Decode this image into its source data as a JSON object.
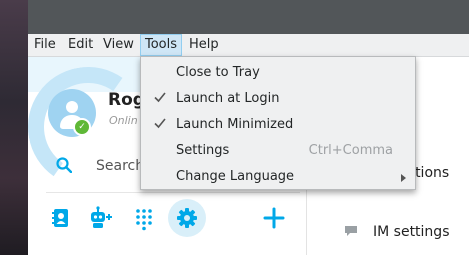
{
  "menubar": {
    "items": [
      {
        "label": "File"
      },
      {
        "label": "Edit"
      },
      {
        "label": "View"
      },
      {
        "label": "Tools",
        "active": true
      },
      {
        "label": "Help"
      }
    ]
  },
  "profile": {
    "name": "Rog",
    "status": "Onlin"
  },
  "search": {
    "label": "Search"
  },
  "toolbar": {
    "icons": [
      "contacts-icon",
      "add-bot-icon",
      "dialpad-icon",
      "settings-gear-icon",
      "plus-icon"
    ]
  },
  "right_pane": {
    "partial_label": "tations",
    "im_settings_label": "IM settings"
  },
  "tools_menu": {
    "items": [
      {
        "label": "Close to Tray",
        "checked": false,
        "shortcut": "",
        "submenu": false
      },
      {
        "label": "Launch at Login",
        "checked": true,
        "shortcut": "",
        "submenu": false
      },
      {
        "label": "Launch Minimized",
        "checked": true,
        "shortcut": "",
        "submenu": false
      },
      {
        "label": "Settings",
        "checked": false,
        "shortcut": "Ctrl+Comma",
        "submenu": false
      },
      {
        "label": "Change Language",
        "checked": false,
        "shortcut": "",
        "submenu": true
      }
    ]
  },
  "colors": {
    "accent": "#00a8e8",
    "online": "#5fb837",
    "menu_highlight": "#cfe6f6"
  }
}
